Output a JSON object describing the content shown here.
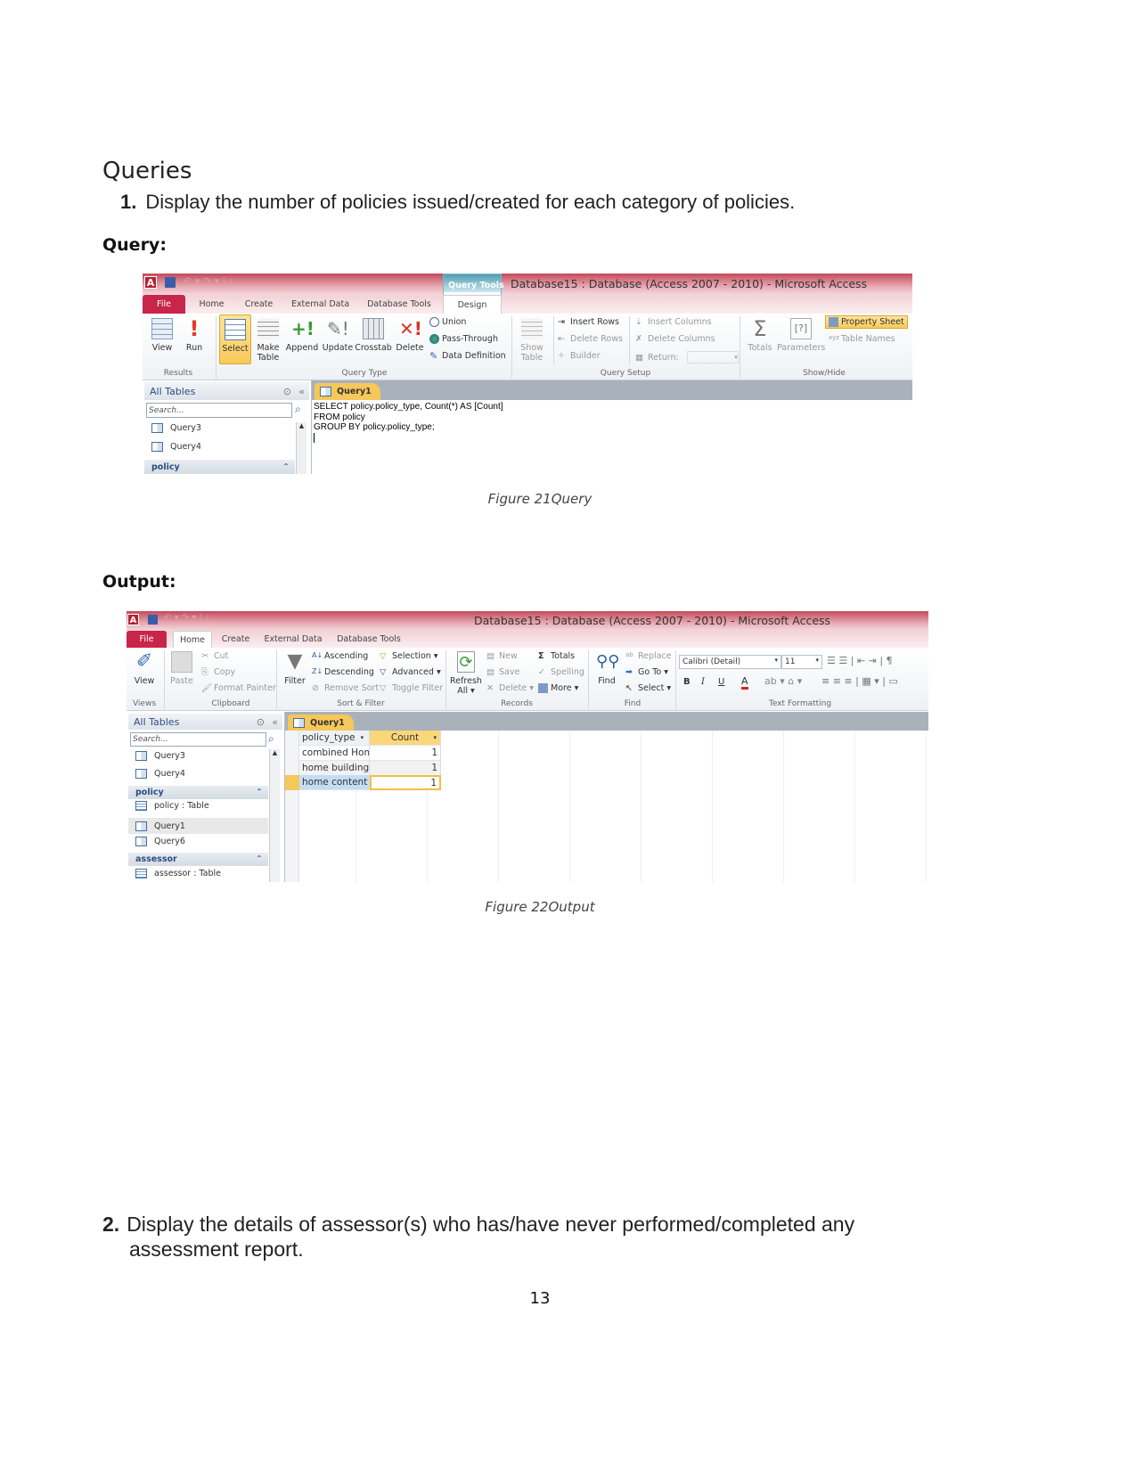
{
  "heading": "Queries",
  "question1": {
    "number": "1.",
    "text": "Display the number of policies issued/created for each category of policies."
  },
  "query_label": "Query:",
  "output_label": "Output:",
  "figure21_caption": "Figure 21Query",
  "figure22_caption": "Figure 22Output",
  "question2": {
    "number": "2.",
    "line1": "Display the details of assessor(s) who has/have never performed/completed any",
    "line2": "assessment report."
  },
  "page_number": "13",
  "shot1": {
    "window_title": "Database15 : Database (Access 2007 - 2010)  -  Microsoft Access",
    "contextual_tab": "Query Tools",
    "tabs": [
      "File",
      "Home",
      "Create",
      "External Data",
      "Database Tools",
      "Design"
    ],
    "results": {
      "view": "View",
      "run": "Run",
      "group": "Results"
    },
    "query_type": {
      "select": "Select",
      "make_table_1": "Make",
      "make_table_2": "Table",
      "append": "Append",
      "update": "Update",
      "crosstab": "Crosstab",
      "delete": "Delete",
      "union": "Union",
      "pass_through": "Pass-Through",
      "data_definition": "Data Definition",
      "group": "Query Type"
    },
    "query_setup": {
      "show_table_1": "Show",
      "show_table_2": "Table",
      "insert_rows": "Insert Rows",
      "delete_rows": "Delete Rows",
      "builder": "Builder",
      "insert_columns": "Insert Columns",
      "delete_columns": "Delete Columns",
      "return": "Return:",
      "group": "Query Setup"
    },
    "show_hide": {
      "totals": "Totals",
      "parameters": "Parameters",
      "property_sheet": "Property Sheet",
      "table_names": "Table Names",
      "group": "Show/Hide"
    },
    "nav": {
      "title": "All Tables",
      "search_placeholder": "Search...",
      "items": [
        "Query3",
        "Query4"
      ],
      "group": "policy"
    },
    "doc_tab": "Query1",
    "sql": [
      "SELECT policy.policy_type, Count(*) AS [Count]",
      "FROM policy",
      "GROUP BY policy.policy_type;"
    ]
  },
  "shot2": {
    "window_title": "Database15 : Database (Access 2007 - 2010)  -  Microsoft Access",
    "tabs": [
      "File",
      "Home",
      "Create",
      "External Data",
      "Database Tools"
    ],
    "views": {
      "view": "View",
      "group": "Views"
    },
    "clipboard": {
      "paste": "Paste",
      "cut": "Cut",
      "copy": "Copy",
      "format_painter": "Format Painter",
      "group": "Clipboard"
    },
    "sort_filter": {
      "filter": "Filter",
      "ascending": "Ascending",
      "descending": "Descending",
      "remove_sort": "Remove Sort",
      "selection": "Selection",
      "advanced": "Advanced",
      "toggle_filter": "Toggle Filter",
      "group": "Sort & Filter"
    },
    "records": {
      "refresh_1": "Refresh",
      "refresh_2": "All",
      "new": "New",
      "save": "Save",
      "delete": "Delete",
      "totals": "Totals",
      "spelling": "Spelling",
      "more": "More",
      "group": "Records"
    },
    "find": {
      "find": "Find",
      "replace": "Replace",
      "go_to": "Go To",
      "select": "Select",
      "group": "Find"
    },
    "text_formatting": {
      "font": "Calibri (Detail)",
      "size": "11",
      "bold": "B",
      "italic": "I",
      "underline": "U",
      "group": "Text Formatting"
    },
    "nav": {
      "title": "All Tables",
      "search_placeholder": "Search...",
      "items_top": [
        "Query3",
        "Query4"
      ],
      "group_policy": "policy",
      "policy_items": [
        "policy : Table",
        "Query1",
        "Query6"
      ],
      "group_assessor": "assessor",
      "assessor_items": [
        "assessor : Table"
      ]
    },
    "doc_tab": "Query1",
    "columns": [
      "policy_type",
      "Count"
    ],
    "rows": [
      [
        "combined Hom",
        "1"
      ],
      [
        "home building",
        "1"
      ],
      [
        "home content",
        "1"
      ]
    ]
  }
}
